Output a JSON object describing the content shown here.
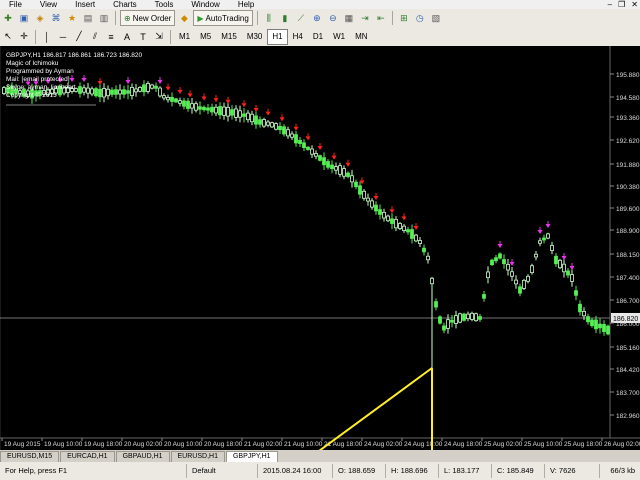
{
  "menu": {
    "items": [
      "File",
      "View",
      "Insert",
      "Charts",
      "Tools",
      "Window",
      "Help"
    ]
  },
  "toolbar": {
    "new_order_label": "New Order",
    "autotrading_label": "AutoTrading",
    "timeframes": [
      "M1",
      "M5",
      "M15",
      "M30",
      "H1",
      "H4",
      "D1",
      "W1",
      "MN"
    ],
    "active_timeframe": "H1"
  },
  "chart": {
    "header": "GBPJPY,H1  186.817 186.861 186.723 186.820",
    "info_lines": [
      "Magic of Ichimoku",
      "Programmed by Ayman",
      "Mail: [email protected]",
      "Skype: ayman_lionheart",
      "Copyright © 2015"
    ],
    "price_ticks": [
      "195.880",
      "194.580",
      "193.360",
      "192.620",
      "191.880",
      "190.380",
      "189.600",
      "188.900",
      "188.150",
      "187.400",
      "186.700",
      "186.000",
      "185.160",
      "184.420",
      "183.700",
      "182.960"
    ],
    "current_price": "186.820",
    "time_ticks": [
      "19 Aug 2015",
      "19 Aug 10:00",
      "19 Aug 18:00",
      "20 Aug 02:00",
      "20 Aug 10:00",
      "20 Aug 18:00",
      "21 Aug 02:00",
      "21 Aug 10:00",
      "21 Aug 18:00",
      "24 Aug 02:00",
      "24 Aug 10:00",
      "24 Aug 18:00",
      "25 Aug 02:00",
      "25 Aug 10:00",
      "25 Aug 18:00",
      "26 Aug 02:00"
    ],
    "colors": {
      "bull": "#ccffcc",
      "bear": "#55ee55",
      "sell_arrow": "#ff2020",
      "buy_arrow": "#ee33ee",
      "annotation": "#ffee22"
    }
  },
  "tabs": [
    "EURUSD,M15",
    "EURCAD,H1",
    "GBPAUD,H1",
    "EURUSD,H1",
    "GBPJPY,H1"
  ],
  "active_tab": "GBPJPY,H1",
  "status": {
    "help": "For Help, press F1",
    "profile": "Default",
    "datetime": "2015.08.24 16:00",
    "open": "O: 188.659",
    "high": "H: 188.696",
    "low": "L: 183.177",
    "close": "C: 185.849",
    "volume": "V: 7626",
    "traffic": "66/3 kb"
  }
}
